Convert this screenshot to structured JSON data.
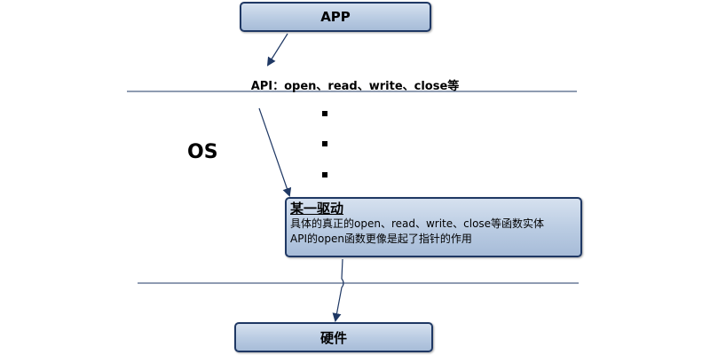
{
  "app_box": {
    "label": "APP"
  },
  "api_label": "API：open、read、write、close等",
  "os_label": "OS",
  "driver_box": {
    "title": "某一驱动",
    "line1": "具体的真正的open、read、write、close等函数实体",
    "line2": "API的open函数更像是起了指针的作用"
  },
  "hardware_box": {
    "label": "硬件"
  },
  "colors": {
    "box_border": "#1f3864",
    "box_fill_top": "#d6e1ef",
    "box_fill_bottom": "#a7bcd8",
    "line": "#1f3864"
  }
}
